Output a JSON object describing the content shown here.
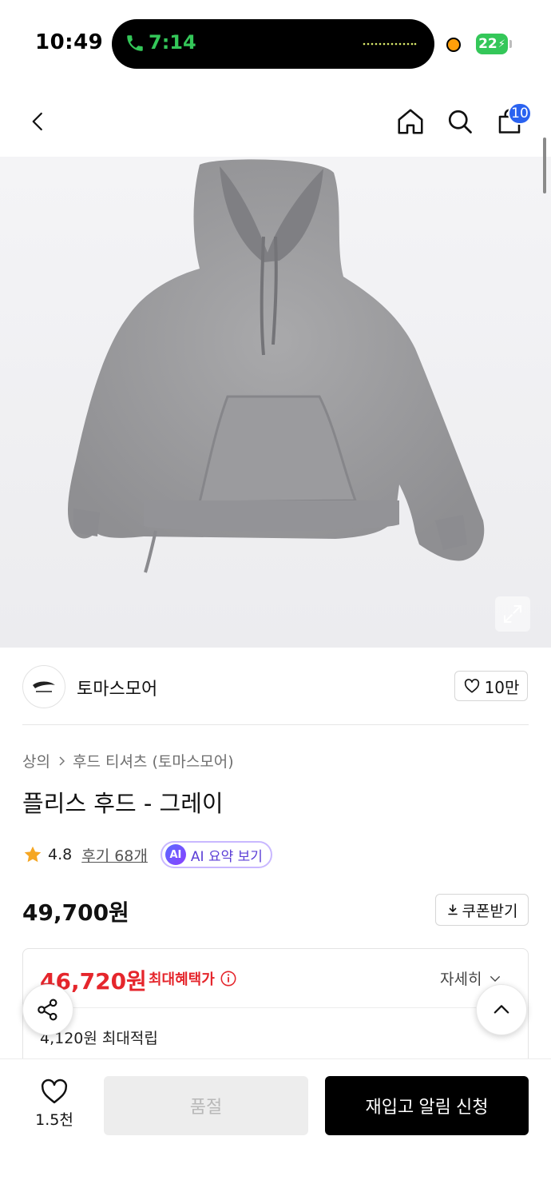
{
  "status_bar": {
    "time": "10:49",
    "call_time": "7:14",
    "battery": "22"
  },
  "header": {
    "cart_count": "10"
  },
  "brand": {
    "name": "토마스모어",
    "like_count": "10만"
  },
  "product": {
    "breadcrumb": [
      "상의",
      "후드 티셔츠 (토마스모어)"
    ],
    "title": "플리스 후드 - 그레이",
    "rating": "4.8",
    "review_label": "후기 68개",
    "ai_badge": "AI",
    "ai_summary_label": "AI 요약 보기",
    "price": "49,700원",
    "coupon_label": "쿠폰받기"
  },
  "benefit": {
    "best_price": "46,720원",
    "best_price_label": "최대혜택가",
    "detail_label": "자세히",
    "points_text": "4,120원 최대적립"
  },
  "bottom_bar": {
    "wish_count": "1.5천",
    "soldout_label": "품절",
    "restock_label": "재입고 알림 신청"
  },
  "icons": {
    "back": "chevron-left-icon",
    "home": "home-icon",
    "search": "search-icon",
    "cart": "bag-icon",
    "expand": "expand-icon",
    "heart": "heart-icon",
    "star": "star-icon",
    "download": "download-icon",
    "info": "info-icon",
    "share": "share-icon",
    "up": "chevron-up-icon"
  },
  "colors": {
    "accent_blue": "#2a62f0",
    "sale_red": "#e5262c",
    "star_orange": "#f5a623",
    "ai_purple": "#5b3ed6",
    "call_green": "#34c759"
  }
}
